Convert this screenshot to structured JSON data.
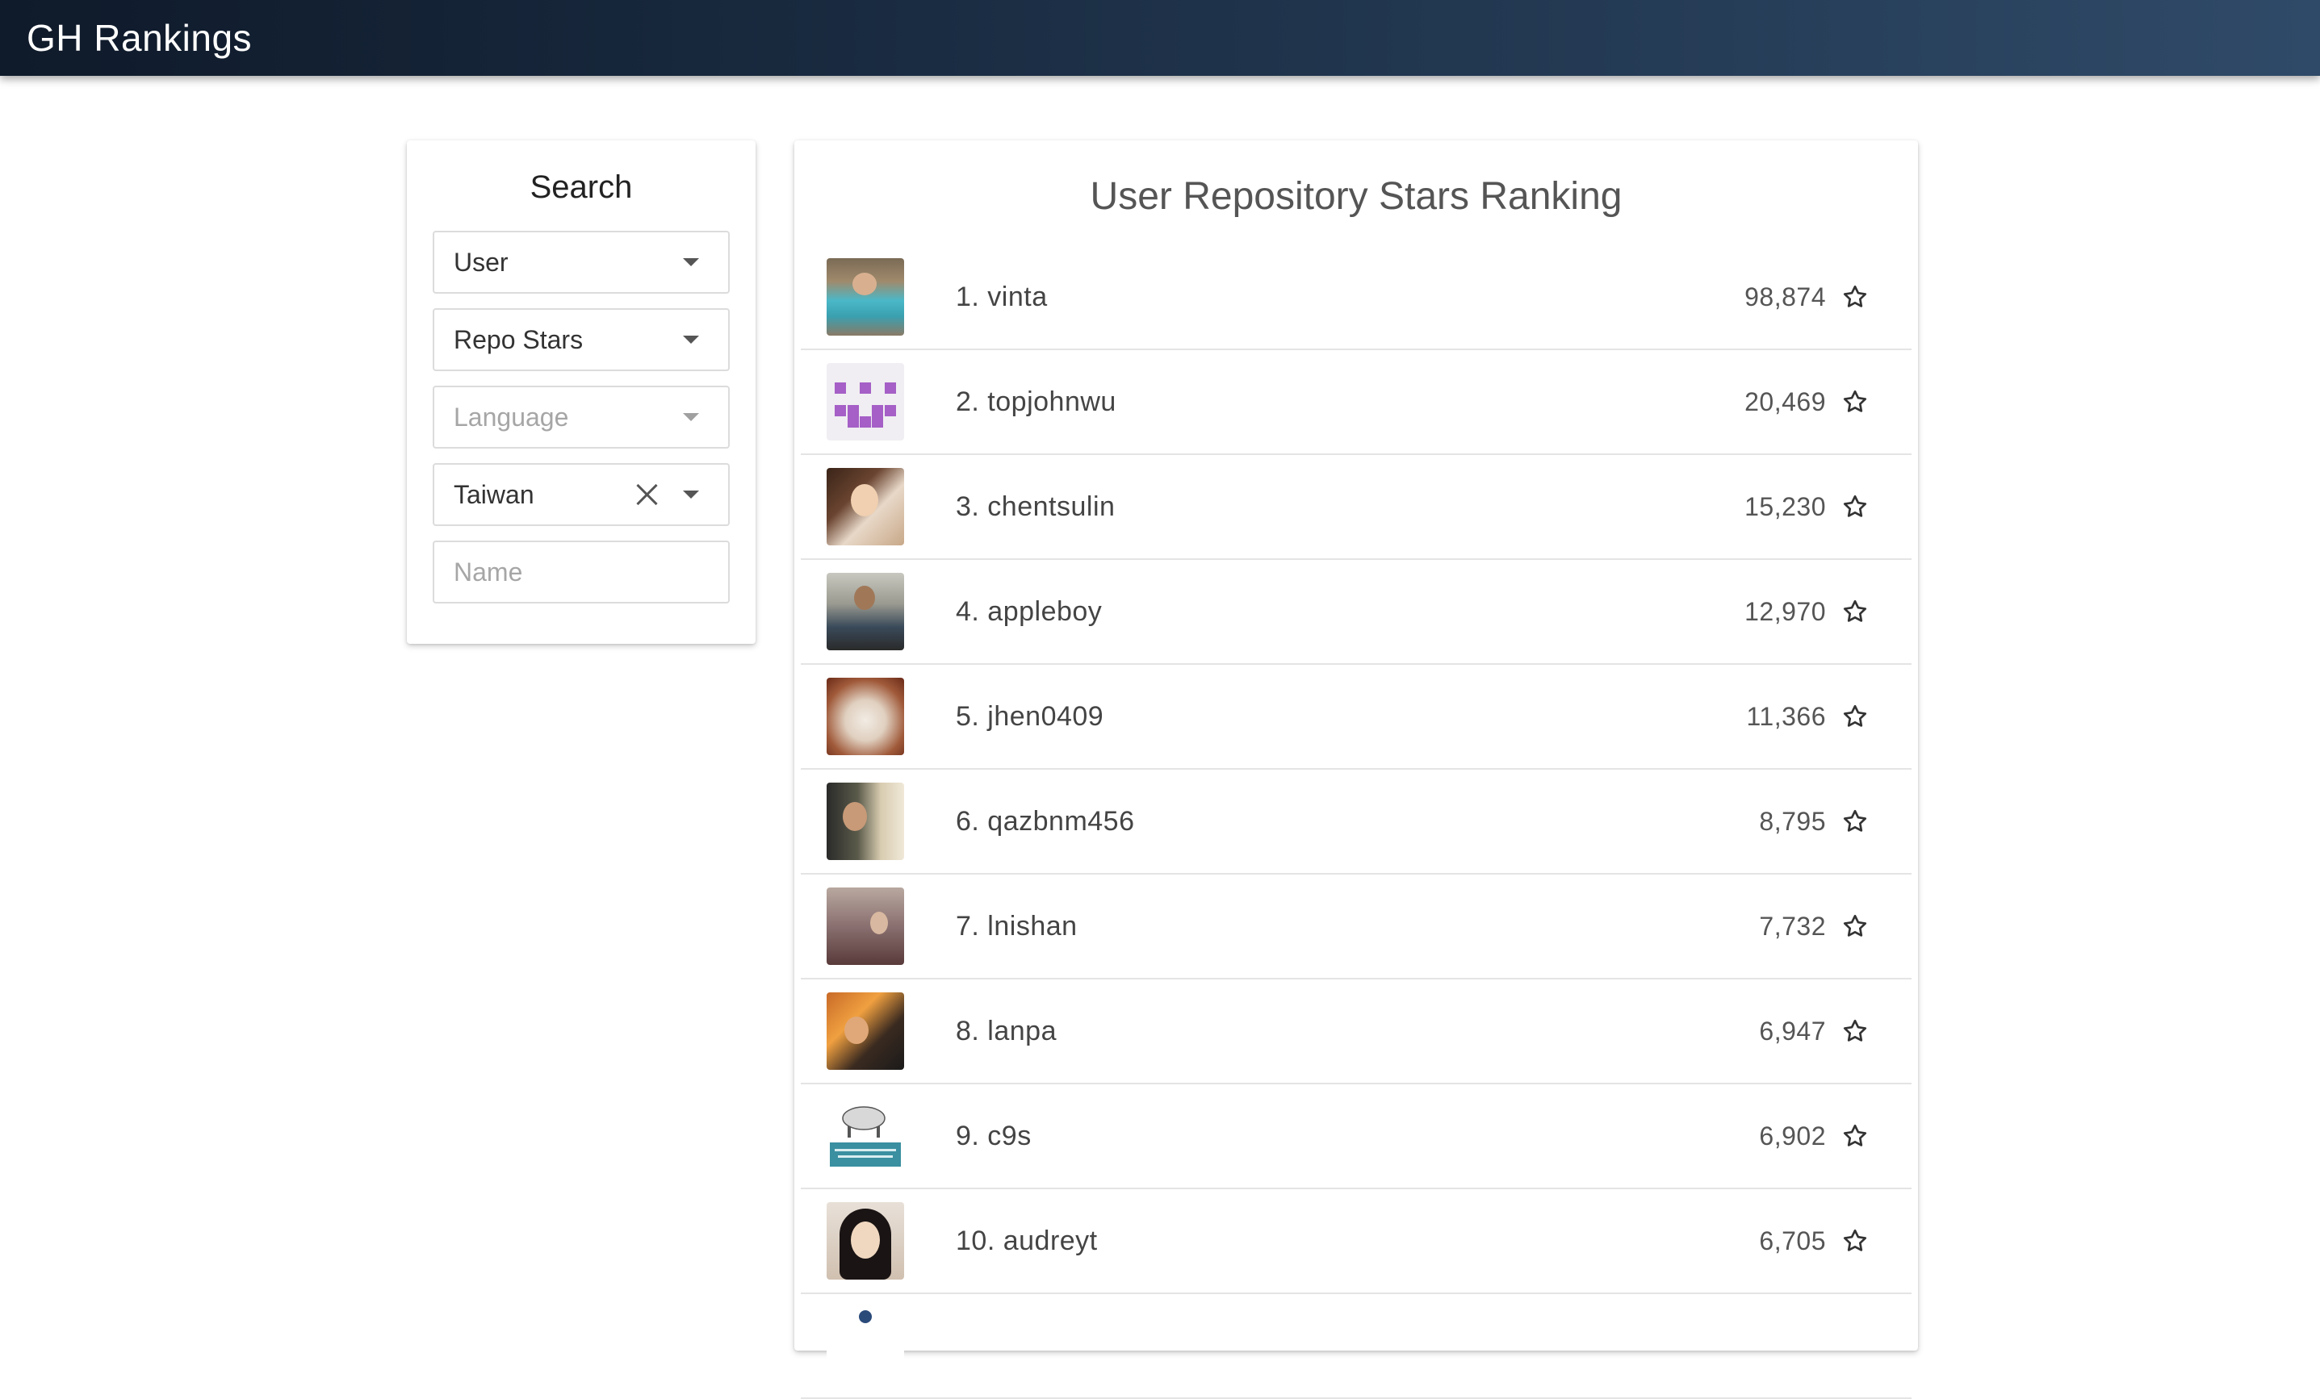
{
  "app": {
    "title": "GH Rankings"
  },
  "search": {
    "title": "Search",
    "type_value": "User",
    "sort_value": "Repo Stars",
    "language_placeholder": "Language",
    "location_value": "Taiwan",
    "name_placeholder": "Name"
  },
  "ranking": {
    "title": "User Repository Stars Ranking",
    "rows": [
      {
        "label": "1. vinta",
        "stars": "98,874"
      },
      {
        "label": "2. topjohnwu",
        "stars": "20,469"
      },
      {
        "label": "3. chentsulin",
        "stars": "15,230"
      },
      {
        "label": "4. appleboy",
        "stars": "12,970"
      },
      {
        "label": "5. jhen0409",
        "stars": "11,366"
      },
      {
        "label": "6. qazbnm456",
        "stars": "8,795"
      },
      {
        "label": "7. lnishan",
        "stars": "7,732"
      },
      {
        "label": "8. lanpa",
        "stars": "6,947"
      },
      {
        "label": "9. c9s",
        "stars": "6,902"
      },
      {
        "label": "10. audreyt",
        "stars": "6,705"
      },
      {
        "label": "",
        "stars": ""
      }
    ]
  },
  "colors": {
    "appbar_start": "#0f1a2a",
    "appbar_end": "#2f4a68",
    "divider": "#e4e4e4"
  },
  "icons": {
    "dropdown": "caret-down-icon",
    "clear": "close-icon",
    "star": "star-outline-icon"
  }
}
